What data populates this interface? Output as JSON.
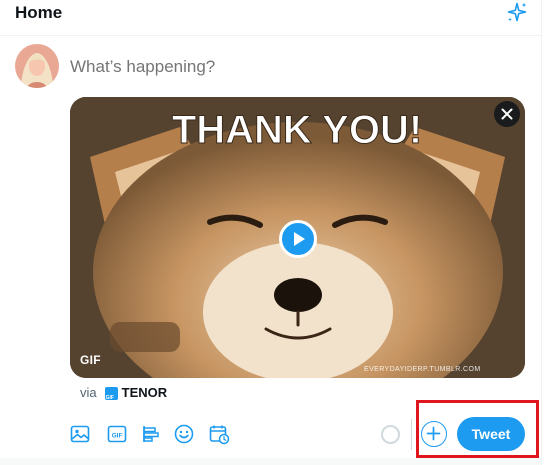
{
  "header": {
    "title": "Home",
    "sparkle_icon": "sparkle-icon"
  },
  "compose": {
    "placeholder": "What’s happening?"
  },
  "media": {
    "caption_text": "THANK YOU!",
    "gif_badge": "GIF",
    "watermark": "EVERYDAYIDERP.TUMBLR.COM",
    "close_icon": "close-icon",
    "play_icon": "play-icon"
  },
  "attribution": {
    "via": "via",
    "logo_text": "GIF",
    "brand": "TENOR"
  },
  "toolbar": {
    "icons": [
      "image-icon",
      "gif-icon",
      "poll-icon",
      "emoji-icon",
      "schedule-icon"
    ],
    "add_icon": "plus-icon",
    "tweet_label": "Tweet"
  },
  "colors": {
    "accent": "#1d9bf0",
    "highlight": "#e0161e",
    "placeholder": "#8b98a5"
  }
}
